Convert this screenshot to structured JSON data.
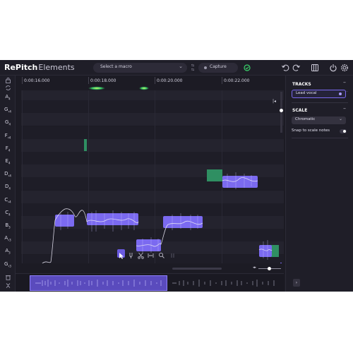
{
  "app": {
    "brand_bold": "RePitch",
    "brand_light": "Elements"
  },
  "header": {
    "macro_label": "Select a macro",
    "capture_label": "Capture",
    "icons": [
      "swap-icon",
      "check-circle-icon",
      "undo-icon",
      "redo-icon",
      "columns-icon",
      "power-icon",
      "settings-icon"
    ]
  },
  "timeline": {
    "ticks": [
      "0:00:16.000",
      "0:00:18.000",
      "0:00:20.000",
      "0:00:22.000"
    ]
  },
  "piano": {
    "notes": [
      {
        "name": "A",
        "sub": "4"
      },
      {
        "name": "G",
        "sub": "♯4"
      },
      {
        "name": "G",
        "sub": "4"
      },
      {
        "name": "F",
        "sub": "♯4"
      },
      {
        "name": "F",
        "sub": "4"
      },
      {
        "name": "E",
        "sub": "4"
      },
      {
        "name": "D",
        "sub": "♯4"
      },
      {
        "name": "D",
        "sub": "4"
      },
      {
        "name": "C",
        "sub": "♯4"
      },
      {
        "name": "C",
        "sub": "4"
      },
      {
        "name": "B",
        "sub": "3"
      },
      {
        "name": "A",
        "sub": "♯3"
      },
      {
        "name": "A",
        "sub": "3"
      },
      {
        "name": "G",
        "sub": "♯3"
      }
    ]
  },
  "panel": {
    "tracks_title": "TRACKS",
    "track_name": "Lead vocal",
    "scale_title": "SCALE",
    "scale_value": "Chromatic",
    "snap_label": "Snap to scale notes",
    "snap_enabled": false
  },
  "colors": {
    "accent": "#7b6af0",
    "background": "#1c1b24",
    "panel": "#1f1e28",
    "green": "#2f8f62"
  }
}
